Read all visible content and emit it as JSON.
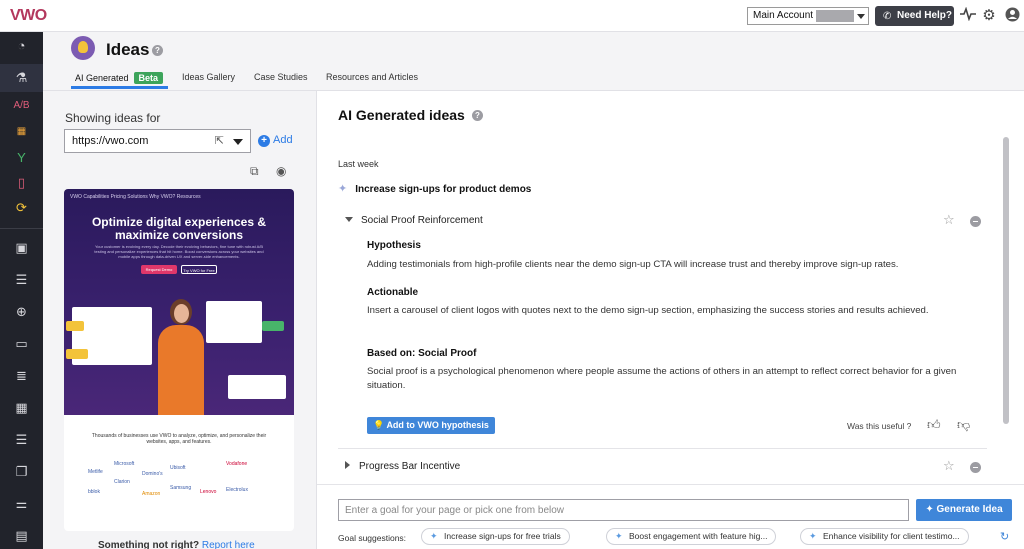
{
  "topbar": {
    "logo": "VWO",
    "account_label": "Main Account",
    "help_label": "Need Help?",
    "icons": [
      "activity-icon",
      "gear-icon",
      "user-icon"
    ]
  },
  "sidebar": {
    "items": [
      "dashboard-icon",
      "flask-icon",
      "ab-test-icon",
      "grid-icon",
      "funnel-icon",
      "mobile-icon",
      "deploy-icon",
      "heatmap-icon",
      "list-icon",
      "target-icon",
      "screen-icon",
      "database-icon",
      "calendar-icon",
      "stack-icon",
      "copy-icon",
      "sliders-icon",
      "briefcase-icon"
    ]
  },
  "header": {
    "title": "Ideas",
    "tabs": [
      {
        "label": "AI Generated",
        "badge": "Beta",
        "active": true
      },
      {
        "label": "Ideas Gallery"
      },
      {
        "label": "Case Studies"
      },
      {
        "label": "Resources and Articles"
      }
    ]
  },
  "left": {
    "showing_label": "Showing ideas for",
    "url_value": "https://vwo.com",
    "add_label": "Add",
    "preview": {
      "nav": "VWO   Capabilities   Pricing   Solutions   Why VWO?   Resources",
      "headline": "Optimize digital experiences & maximize conversions",
      "subtext": "Your customer is evolving every day. Decode their evolving behaviors, fine tune with robust A/B testing and personalize experiences that hit home. Boost conversions across your websites and mobile apps through data-driven UX and server-side enhancements.",
      "btn_primary": "Request Demo",
      "btn_secondary": "Try VWO for Free",
      "logos_text": "Thousands of businesses use VWO to analyze, optimize, and personalize their websites, apps, and features.",
      "logos": [
        "Metlife",
        "Microsoft",
        "Domino's",
        "Ubisoft",
        "Vodafone",
        "bblok",
        "Clarion",
        "Amazon",
        "Samsung",
        "Lenovo",
        "Electrolux"
      ]
    },
    "not_right": "Something not right?",
    "report_here": "Report here"
  },
  "right": {
    "title": "AI Generated ideas",
    "period": "Last week",
    "goal": "Increase sign-ups for product demos",
    "idea1": {
      "title": "Social Proof Reinforcement",
      "hypothesis_label": "Hypothesis",
      "hypothesis_text": "Adding testimonials from high-profile clients near the demo sign-up CTA will increase trust and thereby improve sign-up rates.",
      "actionable_label": "Actionable",
      "actionable_text": "Insert a carousel of client logos with quotes next to the demo sign-up section, emphasizing the success stories and results achieved.",
      "based_label": "Based on: Social Proof",
      "based_text": "Social proof is a psychological phenomenon where people assume the actions of others in an attempt to reflect correct behavior for a given situation.",
      "add_button": "Add to VWO hypothesis",
      "useful_label": "Was this useful ?"
    },
    "idea2": {
      "title": "Progress Bar Incentive"
    },
    "input_placeholder": "Enter a goal for your page or pick one from below",
    "generate_label": "Generate Idea",
    "suggestions_label": "Goal suggestions:",
    "suggestions": [
      "Increase sign-ups for free trials",
      "Boost engagement with feature hig...",
      "Enhance visibility for client testimo..."
    ]
  }
}
